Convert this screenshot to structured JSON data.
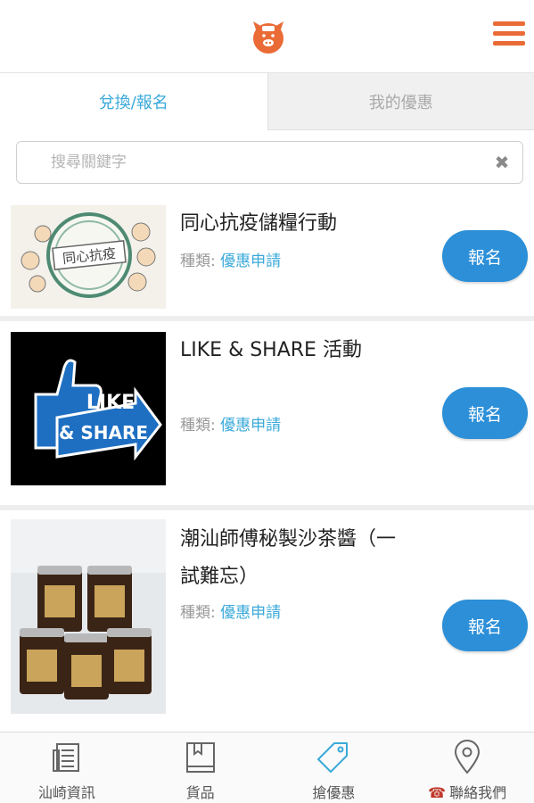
{
  "header": {
    "logo_icon": "pig-mascot-icon",
    "menu_icon": "hamburger-icon",
    "accent": "#ea6b36"
  },
  "tabs": [
    {
      "label": "兌換/報名",
      "active": true
    },
    {
      "label": "我的優惠",
      "active": false
    }
  ],
  "search": {
    "placeholder": "搜尋關鍵字",
    "value": "",
    "clear_icon": "close-icon"
  },
  "items": [
    {
      "title": "同心抗疫儲糧行動",
      "category_label": "種類:",
      "category_value": "優惠申請",
      "button": "報名",
      "image_text": "同心抗疫"
    },
    {
      "title": "LIKE & SHARE 活動",
      "category_label": "種類:",
      "category_value": "優惠申請",
      "button": "報名",
      "image_text_1": "LIKE",
      "image_text_2": "& SHARE"
    },
    {
      "title": "潮汕師傅秘製沙茶醬（一試難忘）",
      "category_label": "種類:",
      "category_value": "優惠申請",
      "button": "報名"
    }
  ],
  "bottom_nav": [
    {
      "label": "汕崎資訊",
      "icon": "news-icon"
    },
    {
      "label": "貨品",
      "icon": "book-icon"
    },
    {
      "label": "搶優惠",
      "icon": "tag-icon"
    },
    {
      "label": "聯絡我們",
      "icon": "location-pin-icon",
      "prefix_icon": "telephone-icon"
    }
  ],
  "colors": {
    "link_blue": "#3aa9d9",
    "button_blue": "#2c8fd8",
    "brand_orange": "#ea6b36"
  }
}
